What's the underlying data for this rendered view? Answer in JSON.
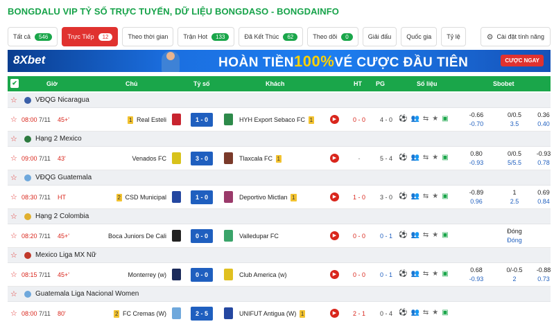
{
  "page_title": "BONGDALU VIP TỶ SỐ TRỰC TUYẾN, DỮ LIỆU BONGDASO - BONGDAINFO",
  "tabs": [
    {
      "label": "Tất cả",
      "badge": "546"
    },
    {
      "label": "Trực Tiếp",
      "badge": "12",
      "active": true
    },
    {
      "label": "Theo thời gian",
      "badge": ""
    },
    {
      "label": "Trận Hot",
      "badge": "133"
    },
    {
      "label": "Đã Kết Thúc",
      "badge": "62"
    },
    {
      "label": "Theo dõi",
      "badge": "0"
    },
    {
      "label": "Giải đấu",
      "badge": ""
    },
    {
      "label": "Quốc gia",
      "badge": ""
    },
    {
      "label": "Tỷ lệ",
      "badge": ""
    }
  ],
  "settings_label": "Cài đặt tính năng",
  "banner": {
    "brand": "8Xbet",
    "promo_pre": "HOÀN TIỀN",
    "promo_highlight": "100%",
    "promo_post": "VÉ CƯỢC ĐẦU TIÊN",
    "cta": "CƯỢC NGAY"
  },
  "table_header": {
    "time": "Giờ",
    "home": "Chủ",
    "score": "Tỷ số",
    "away": "Khách",
    "ht": "HT",
    "pg": "PG",
    "stats": "Số liệu",
    "odds": "Sbobet"
  },
  "leagues": [
    {
      "name": "VĐQG Nicaragua",
      "match": {
        "time": "08:00",
        "date": "7/11",
        "minute": "45+'",
        "home_card": "1",
        "home": "Real Esteli",
        "score": "1 - 0",
        "away": "HYH Export Sebaco FC",
        "away_card": "1",
        "ht": "0 - 0",
        "pg": "4 - 0",
        "odds": [
          [
            "-0.66",
            "-0.70"
          ],
          [
            "0/0.5",
            "3.5"
          ],
          [
            "0.36",
            "0.40"
          ]
        ]
      }
    },
    {
      "name": "Hạng 2 Mexico",
      "match": {
        "time": "09:00",
        "date": "7/11",
        "minute": "43'",
        "home_card": "",
        "home": "Venados FC",
        "score": "3 - 0",
        "away": "Tlaxcala FC",
        "away_card": "1",
        "ht": "-",
        "pg": "5 - 4",
        "odds": [
          [
            "0.80",
            "-0.93"
          ],
          [
            "0/0.5",
            "5/5.5"
          ],
          [
            "-0.93",
            "0.78"
          ]
        ]
      }
    },
    {
      "name": "VĐQG Guatemala",
      "match": {
        "time": "08:30",
        "date": "7/11",
        "minute": "HT",
        "home_card": "2",
        "home": "CSD Municipal",
        "score": "1 - 0",
        "away": "Deportivo Mictlan",
        "away_card": "1",
        "ht": "1 - 0",
        "pg": "3 - 0",
        "odds": [
          [
            "-0.89",
            "0.96"
          ],
          [
            "1",
            "2.5"
          ],
          [
            "0.69",
            "0.84"
          ]
        ]
      }
    },
    {
      "name": "Hạng 2 Colombia",
      "match": {
        "time": "08:20",
        "date": "7/11",
        "minute": "45+'",
        "home_card": "",
        "home": "Boca Juniors De Cali",
        "score": "0 - 0",
        "away": "Valledupar FC",
        "away_card": "",
        "ht": "0 - 0",
        "pg": "0 - 1",
        "odds": [
          [
            "",
            ""
          ],
          [
            "Đóng",
            "Đóng"
          ],
          [
            "",
            ""
          ]
        ]
      }
    },
    {
      "name": "Mexico Liga MX Nữ",
      "match": {
        "time": "08:15",
        "date": "7/11",
        "minute": "45+'",
        "home_card": "",
        "home": "Monterrey (w)",
        "score": "0 - 0",
        "away": "Club America (w)",
        "away_card": "",
        "ht": "0 - 0",
        "pg": "0 - 1",
        "odds": [
          [
            "0.68",
            "-0.93"
          ],
          [
            "0/-0.5",
            "2"
          ],
          [
            "-0.88",
            "0.73"
          ]
        ]
      }
    },
    {
      "name": "Guatemala Liga Nacional Women",
      "match": {
        "time": "08:00",
        "date": "7/11",
        "minute": "80'",
        "home_card": "2",
        "home": "FC Cremas (W)",
        "score": "2 - 5",
        "away": "UNIFUT Antigua (W)",
        "away_card": "1",
        "ht": "2 - 1",
        "pg": "0 - 4",
        "odds": [
          [
            "",
            ""
          ],
          [
            "",
            ""
          ],
          [
            "",
            ""
          ]
        ]
      }
    }
  ],
  "colors": {
    "green": "#1aa64a",
    "red": "#e0322f",
    "score_blue": "#1f5fbf"
  }
}
